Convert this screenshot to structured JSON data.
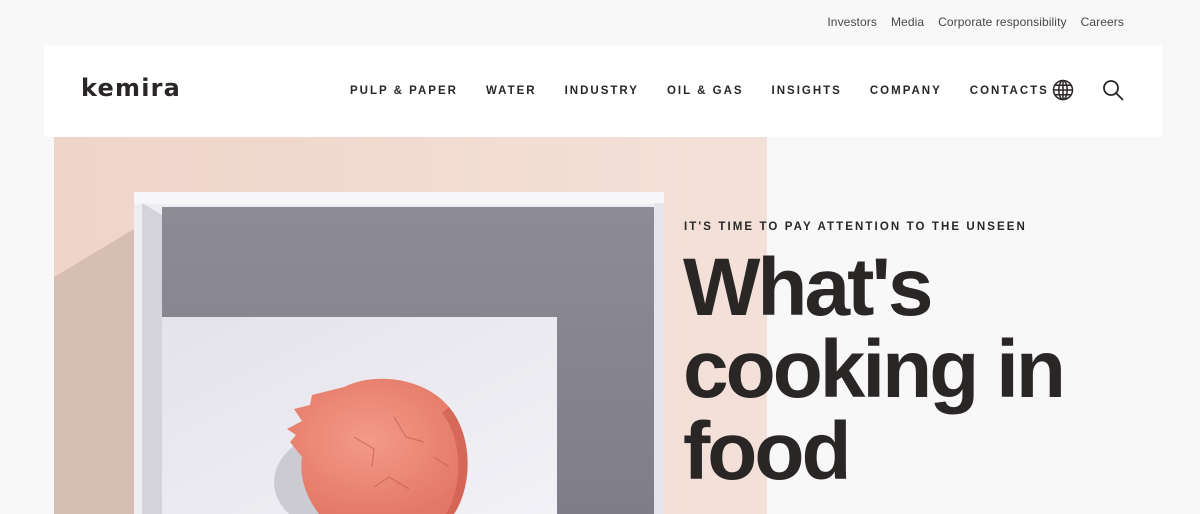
{
  "utility_nav": {
    "items": [
      "Investors",
      "Media",
      "Corporate responsibility",
      "Careers"
    ]
  },
  "header": {
    "logo": "kemira",
    "nav": [
      "PULP & PAPER",
      "WATER",
      "INDUSTRY",
      "OIL & GAS",
      "INSIGHTS",
      "COMPANY",
      "CONTACTS"
    ],
    "icons": [
      "globe-icon",
      "search-icon"
    ]
  },
  "hero": {
    "eyebrow": "IT'S TIME TO PAY ATTENTION TO THE UNSEEN",
    "headline": "What's cooking in food",
    "image_description_icon": "macaron-in-box-image"
  },
  "colors": {
    "text": "#2a2626",
    "page_bg": "#f8f8f8",
    "header_bg": "#ffffff",
    "photo_bg": "#f0dbd2",
    "box": "#c9c8d1",
    "macaron": "#ef8a78"
  }
}
